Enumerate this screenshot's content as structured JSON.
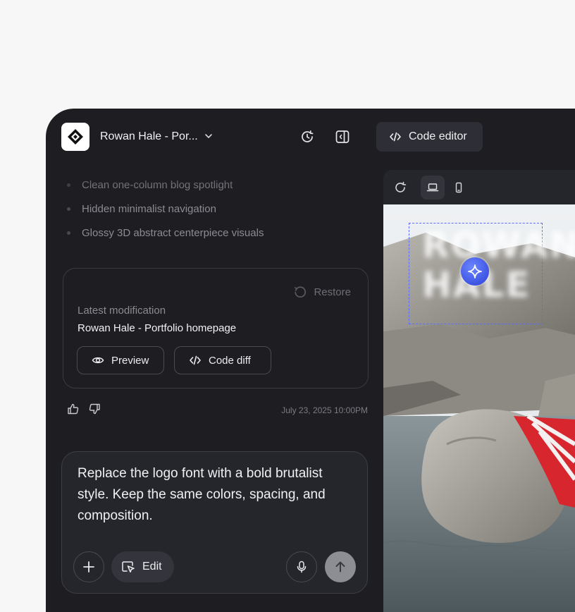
{
  "header": {
    "project_title": "Rowan Hale - Por...",
    "code_editor_label": "Code editor"
  },
  "chat": {
    "features": [
      "Clean one-column blog spotlight",
      "Hidden minimalist navigation",
      "Glossy 3D abstract centerpiece visuals"
    ]
  },
  "modification_card": {
    "restore_label": "Restore",
    "label": "Latest modification",
    "name": "Rowan Hale - Portfolio homepage",
    "preview_label": "Preview",
    "code_diff_label": "Code diff"
  },
  "feedback": {
    "timestamp": "July 23, 2025 10:00PM"
  },
  "composer": {
    "text": "Replace the logo font with a bold brutalist style. Keep the same colors, spacing, and composition.",
    "edit_label": "Edit"
  },
  "preview": {
    "logo_text": "ROWAN HALE"
  },
  "colors": {
    "app_bg": "#1d1d22",
    "accent": "#4a5cf0",
    "towel_red": "#d8262e"
  }
}
